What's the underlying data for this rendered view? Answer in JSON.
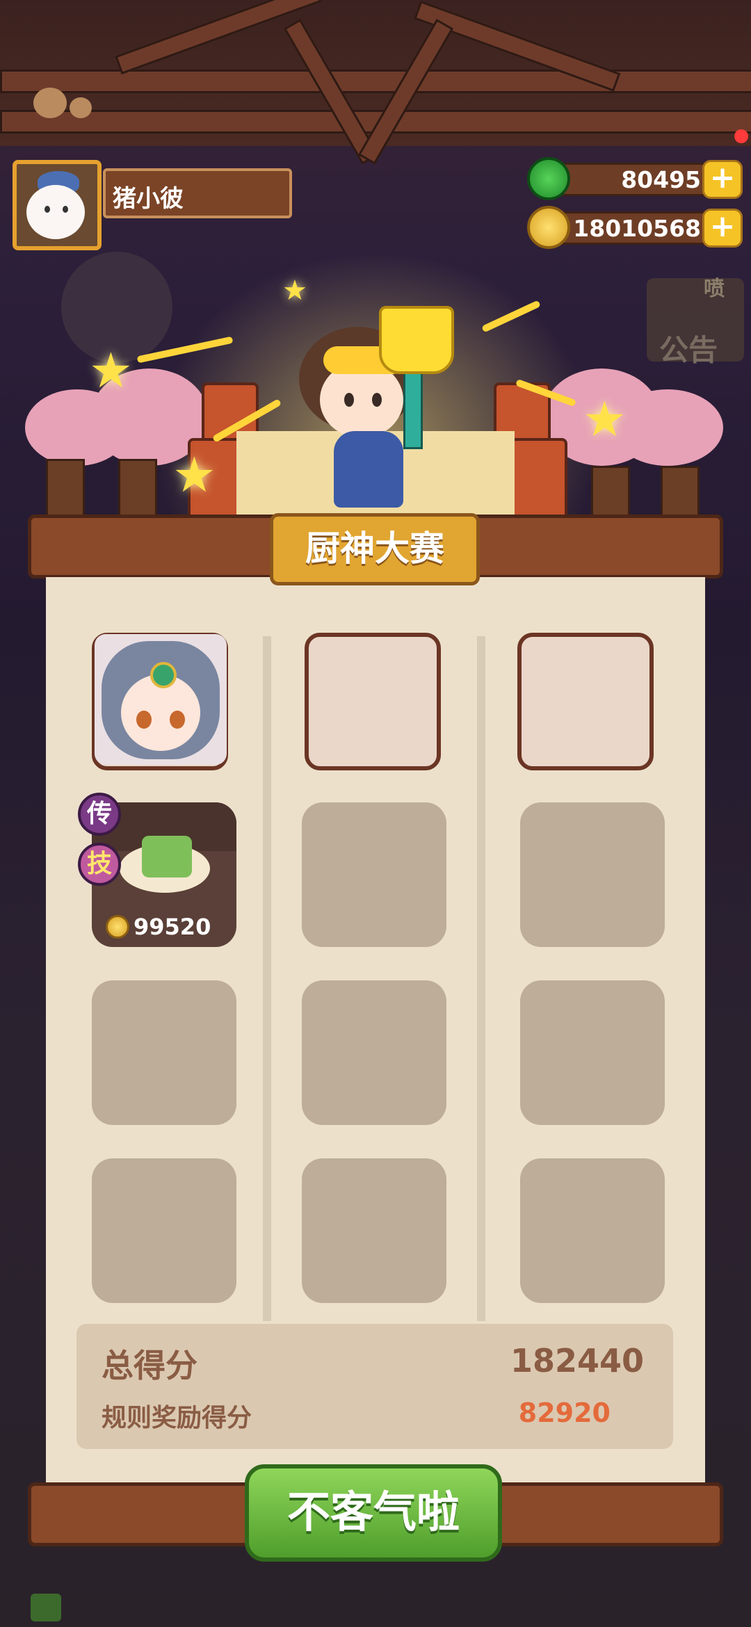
{
  "player": {
    "name": "猪小彼"
  },
  "resources": {
    "jade": {
      "value": "80495",
      "icon": "jade-icon"
    },
    "coin": {
      "value": "18010568",
      "icon": "coin-icon"
    },
    "plus_label": "+"
  },
  "notice": {
    "label": "公告",
    "corner": "喷"
  },
  "contest": {
    "title": "厨神大赛"
  },
  "slots": {
    "dish": {
      "price": "99520",
      "tag_rarity": "传",
      "tag_skill": "技"
    }
  },
  "score": {
    "total_label": "总得分",
    "total_value": "182440",
    "bonus_label": "规则奖励得分",
    "bonus_value": "82920"
  },
  "confirm_button": {
    "label": "不客气啦"
  },
  "colors": {
    "accent": "#e1a531",
    "button_green": "#6cbc3f",
    "bonus": "#e46a3b"
  }
}
